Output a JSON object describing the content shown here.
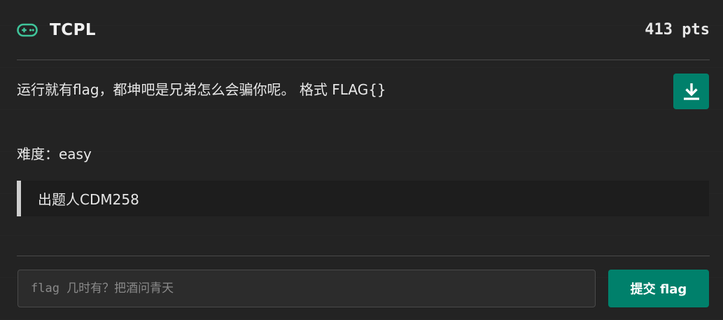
{
  "challenge": {
    "title": "TCPL",
    "points": "413 pts",
    "description": "运行就有flag，都坤吧是兄弟怎么会骗你呢。 格式 FLAG{}",
    "difficulty": "难度：easy",
    "author": "出题人CDM258"
  },
  "submission": {
    "placeholder": "flag 几时有？把酒问青天",
    "value": "",
    "submit_label": "提交 flag"
  },
  "icons": {
    "category": "gamepad-icon",
    "download": "download-icon"
  },
  "colors": {
    "accent": "#00806b",
    "icon_green": "#3fc49a",
    "background": "#232323"
  }
}
